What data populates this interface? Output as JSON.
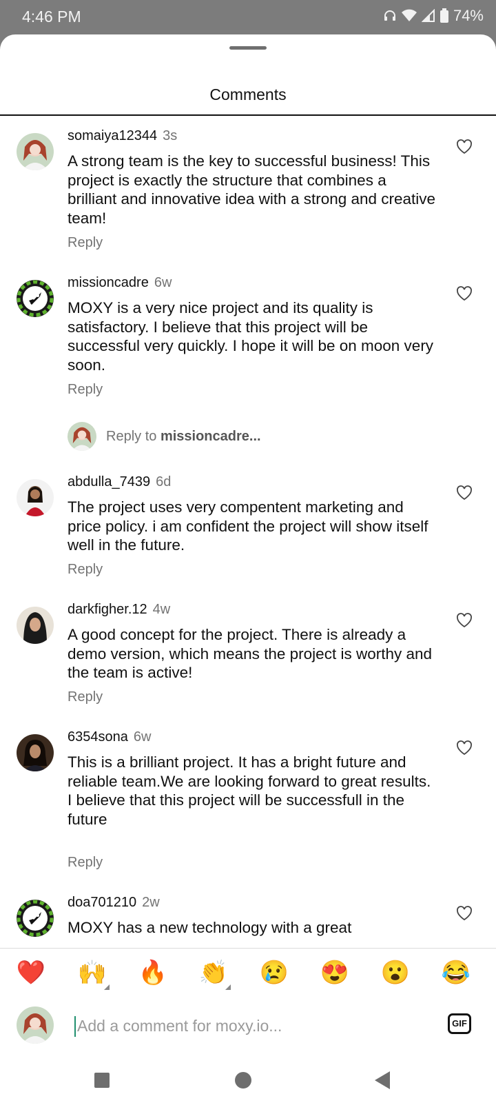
{
  "status_bar": {
    "time": "4:46 PM",
    "battery": "74%",
    "icons": [
      "headphones-icon",
      "wifi-icon",
      "signal-icon",
      "battery-icon"
    ]
  },
  "sheet": {
    "title": "Comments"
  },
  "comments": [
    {
      "username": "somaiya12344",
      "time": "3s",
      "text": "A strong team is the key to successful business! This project is exactly the structure that combines a brilliant and innovative idea with a strong and creative team!",
      "reply_label": "Reply",
      "avatar": "avatar-woman-red-hair"
    },
    {
      "username": "missioncadre",
      "time": "6w",
      "text": "MOXY is a very nice project and its quality is satisfactory. I believe that this project will be successful very quickly. I hope it will be on moon very soon.",
      "reply_label": "Reply",
      "avatar": "avatar-rocket-logo"
    },
    {
      "username": "abdulla_7439",
      "time": "6d",
      "text": "The project uses very compentent marketing and price policy. i am confident the project will show itself well in the future.",
      "reply_label": "Reply",
      "avatar": "avatar-woman-red-dress"
    },
    {
      "username": "darkfigher.12",
      "time": "4w",
      "text": "A good concept for the project. There is already a demo version, which means the project is worthy and the team is active!",
      "reply_label": "Reply",
      "avatar": "avatar-woman-hijab"
    },
    {
      "username": "6354sona",
      "time": "6w",
      "text": "This is a brilliant project. It has a bright future and reliable team.We are looking forward to great results.\nI believe that this project will be successfull in the future",
      "reply_label": "Reply",
      "avatar": "avatar-woman-dark-hair"
    },
    {
      "username": "doa701210",
      "time": "2w",
      "text": "MOXY has a new technology with a great",
      "avatar": "avatar-rocket-logo"
    }
  ],
  "reply_to": {
    "prefix": "Reply to ",
    "username": "missioncadre..."
  },
  "emoji_bar": [
    "❤️",
    "🙌",
    "🔥",
    "👏",
    "😢",
    "😍",
    "😮",
    "😂"
  ],
  "input": {
    "placeholder": "Add a comment for moxy.io...",
    "gif_label": "GIF"
  },
  "nav": {
    "icons": [
      "recents-square-icon",
      "home-circle-icon",
      "back-triangle-icon"
    ]
  },
  "colors": {
    "status_bar_bg": "#7c7c7c",
    "muted_text": "#737373",
    "caret": "#1f8f6e"
  }
}
